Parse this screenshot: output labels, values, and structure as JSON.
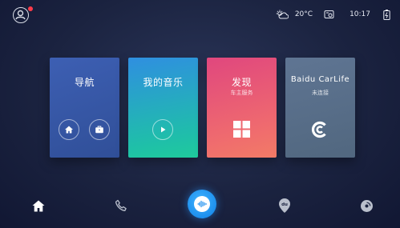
{
  "status_bar": {
    "temperature": "20°C",
    "time": "10:17",
    "icons": [
      "user-avatar-icon",
      "weather-partly-cloudy-icon",
      "storage-icon",
      "battery-icon"
    ]
  },
  "cards": [
    {
      "title": "导航",
      "subtitle": "",
      "buttons": [
        "home-icon",
        "briefcase-icon"
      ]
    },
    {
      "title": "我的音乐",
      "subtitle": "",
      "buttons": [
        "play-icon"
      ]
    },
    {
      "title": "发现",
      "subtitle": "车主服务",
      "buttons": [
        "grid-icon"
      ]
    },
    {
      "title": "Baidu CarLife",
      "subtitle": "未连接",
      "buttons": [
        "carlife-logo-icon"
      ]
    }
  ],
  "dock": {
    "items": [
      "home-icon",
      "phone-icon",
      "voice-assistant-icon",
      "map-pin-icon",
      "music-disc-icon"
    ],
    "active": "home-icon",
    "map_pin_label": "du"
  },
  "colors": {
    "nav_card": "#3a5aac",
    "music_card_top": "#2f8fe0",
    "music_card_bottom": "#1fcb9c",
    "discover_card_top": "#e0477e",
    "discover_card_bottom": "#f27b66",
    "carlife_card": "#5a7090",
    "voice_button": "#1d8fee",
    "notification_dot": "#ff3b4a"
  }
}
